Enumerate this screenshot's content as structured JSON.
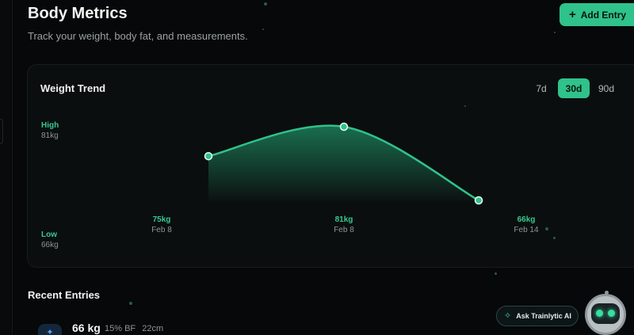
{
  "header": {
    "title": "Body Metrics",
    "subtitle": "Track your weight, body fat, and measurements.",
    "add_entry_label": "Add Entry"
  },
  "weight_card": {
    "title": "Weight Trend",
    "ranges": [
      "7d",
      "30d",
      "90d"
    ],
    "active_range": "30d",
    "high": {
      "label": "High",
      "value": "81kg"
    },
    "low": {
      "label": "Low",
      "value": "66kg"
    }
  },
  "chart_data": {
    "type": "area",
    "points": [
      {
        "weight_label": "75kg",
        "date": "Feb 8",
        "value": 75
      },
      {
        "weight_label": "81kg",
        "date": "Feb 8",
        "value": 81
      },
      {
        "weight_label": "66kg",
        "date": "Feb 14",
        "value": 66
      }
    ],
    "ylim": [
      66,
      81
    ],
    "grid": false,
    "colors": {
      "line": "#2fc28a",
      "fill": "#1f8f64"
    }
  },
  "recent_entries": {
    "title": "Recent Entries",
    "items": [
      {
        "weight": "66 kg",
        "body_fat": "15% BF",
        "measure": "22cm",
        "icon": "body-icon"
      }
    ]
  },
  "assistant": {
    "label": "Ask Trainlytic AI",
    "icon": "sparkle-icon"
  },
  "colors": {
    "accent": "#2fc28a",
    "background": "#060809",
    "card": "#0b0e0f"
  }
}
